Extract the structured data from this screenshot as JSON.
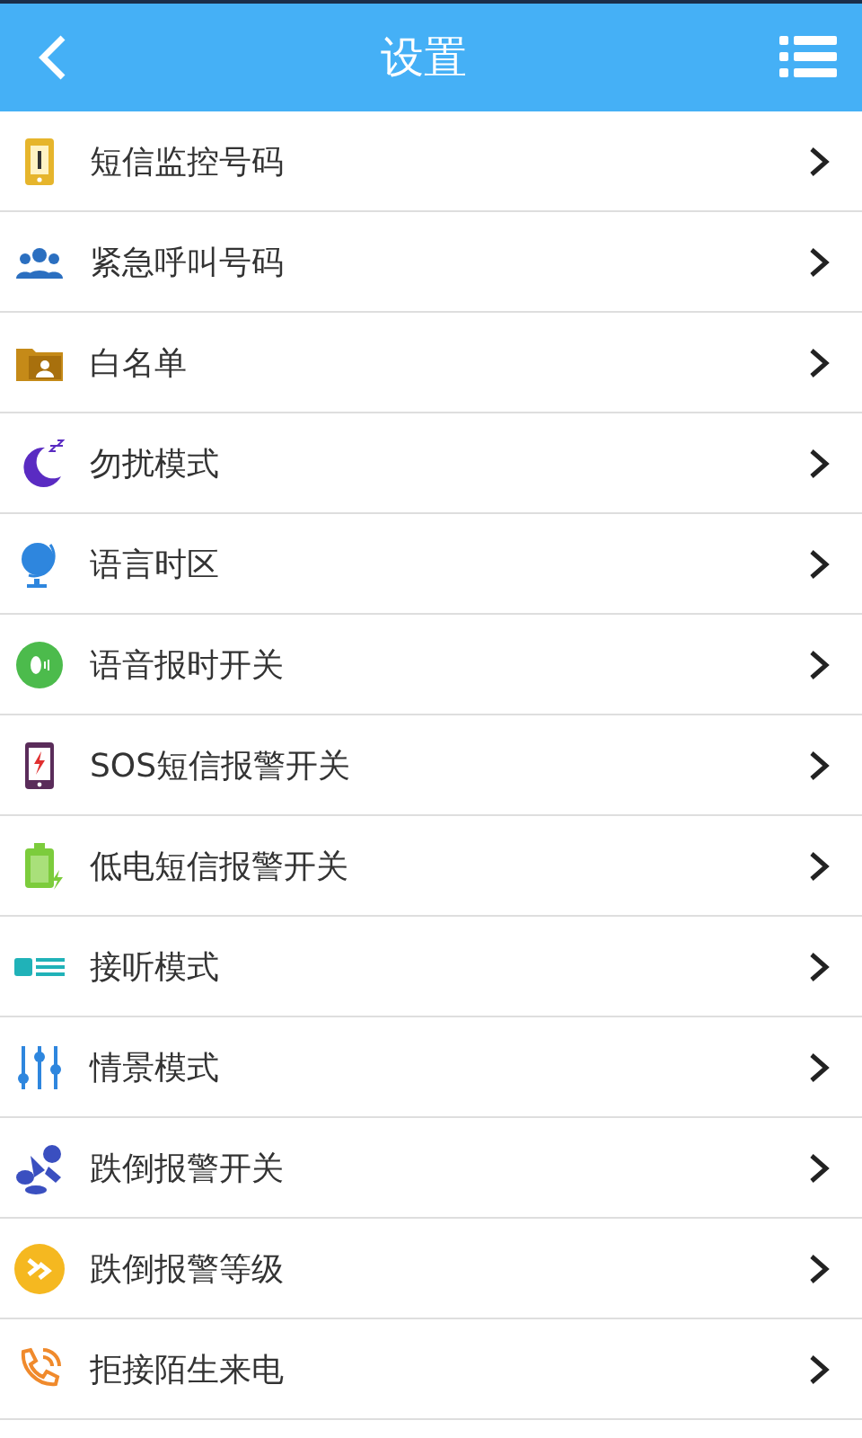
{
  "header": {
    "title": "设置"
  },
  "items": [
    {
      "kind": "phone",
      "label": "短信监控号码"
    },
    {
      "kind": "people",
      "label": "紧急呼叫号码"
    },
    {
      "kind": "folder",
      "label": "白名单"
    },
    {
      "kind": "moon",
      "label": "勿扰模式"
    },
    {
      "kind": "globe",
      "label": "语言时区"
    },
    {
      "kind": "voice",
      "label": "语音报时开关"
    },
    {
      "kind": "sos",
      "label": "SOS短信报警开关"
    },
    {
      "kind": "battery",
      "label": "低电短信报警开关"
    },
    {
      "kind": "answer",
      "label": "接听模式"
    },
    {
      "kind": "sliders",
      "label": "情景模式"
    },
    {
      "kind": "fall",
      "label": "跌倒报警开关"
    },
    {
      "kind": "level",
      "label": "跌倒报警等级"
    },
    {
      "kind": "reject",
      "label": "拒接陌生来电"
    }
  ]
}
